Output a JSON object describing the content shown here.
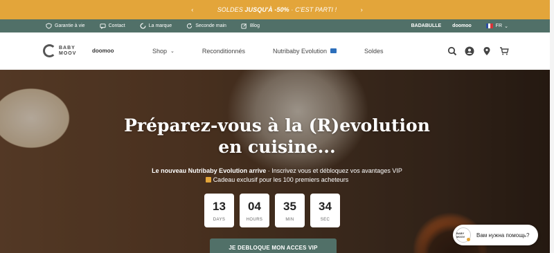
{
  "promo": {
    "prev": "‹",
    "next": "›",
    "soldes": "SOLDES",
    "jusqu": "JUSQU'À -50%",
    "rest": "· C'EST PARTI !"
  },
  "utility": {
    "items": [
      {
        "label": "Garantie à vie",
        "icon": "shield-icon"
      },
      {
        "label": "Contact",
        "icon": "chat-icon"
      },
      {
        "label": "La marque",
        "icon": "brand-icon"
      },
      {
        "label": "Seconde main",
        "icon": "refresh-icon"
      },
      {
        "label": "Blog",
        "icon": "edit-icon"
      }
    ],
    "brands": [
      "BADABULLE",
      "doomoo"
    ],
    "lang": "FR"
  },
  "nav": {
    "logo_word": "BABY MOOV",
    "logo_sub": "doomoo",
    "menu": [
      {
        "label": "Shop"
      },
      {
        "label": "Reconditionnés"
      },
      {
        "label": "Nutribaby Evolution"
      },
      {
        "label": "Soldes"
      }
    ]
  },
  "hero": {
    "title_line1": "Préparez-vous à la (R)evolution",
    "title_line2": "en cuisine...",
    "sub_bold": "Le nouveau Nutribaby Evolution arrive",
    "sub_rest": " · Inscrivez vous et débloquez vos avantages VIP",
    "gift_text": "Cadeau exclusif pour les 100 premiers acheteurs",
    "countdown": [
      {
        "value": "13",
        "label": "DAYS"
      },
      {
        "value": "04",
        "label": "HOURS"
      },
      {
        "value": "35",
        "label": "MIN"
      },
      {
        "value": "34",
        "label": "SEC"
      }
    ],
    "cta": "JE DEBLOQUE MON ACCES VIP"
  },
  "chat": {
    "avatar_text": "BABY MOOV",
    "text": "Вам нужна помощь?"
  },
  "colors": {
    "promo": "#e3a53a",
    "util": "#517068",
    "cta": "#517068"
  }
}
